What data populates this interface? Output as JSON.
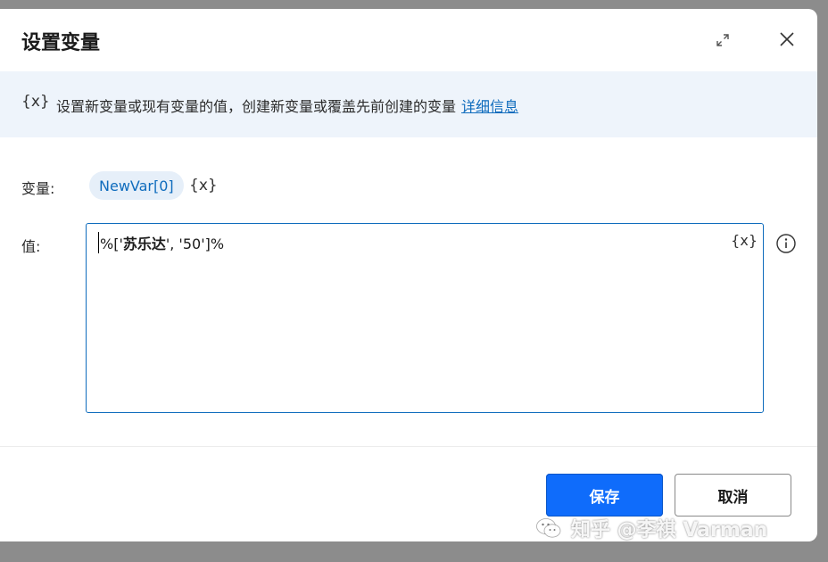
{
  "dialog": {
    "title": "设置变量",
    "expand_icon": "expand-arrows-icon",
    "close_icon": "close-icon"
  },
  "banner": {
    "icon_text": "{x}",
    "text": "设置新变量或现有变量的值，创建新变量或覆盖先前创建的变量",
    "link": "详细信息"
  },
  "form": {
    "variable_label": "变量:",
    "variable_name": "NewVar[0]",
    "variable_picker_icon": "{x}",
    "value_label": "值:",
    "value_prefix": "%['",
    "value_bold": "苏乐达",
    "value_suffix": "', '50']%",
    "value_picker_icon": "{x}",
    "info_icon": "info-circle-icon"
  },
  "footer": {
    "save_label": "保存",
    "cancel_label": "取消"
  },
  "watermark": {
    "text": "知乎 @李祺 Varman"
  },
  "colors": {
    "accent": "#0f6cbd",
    "primary_button": "#0f6cfb",
    "banner_bg": "#eef4fb",
    "chip_bg": "#e6eff9"
  }
}
